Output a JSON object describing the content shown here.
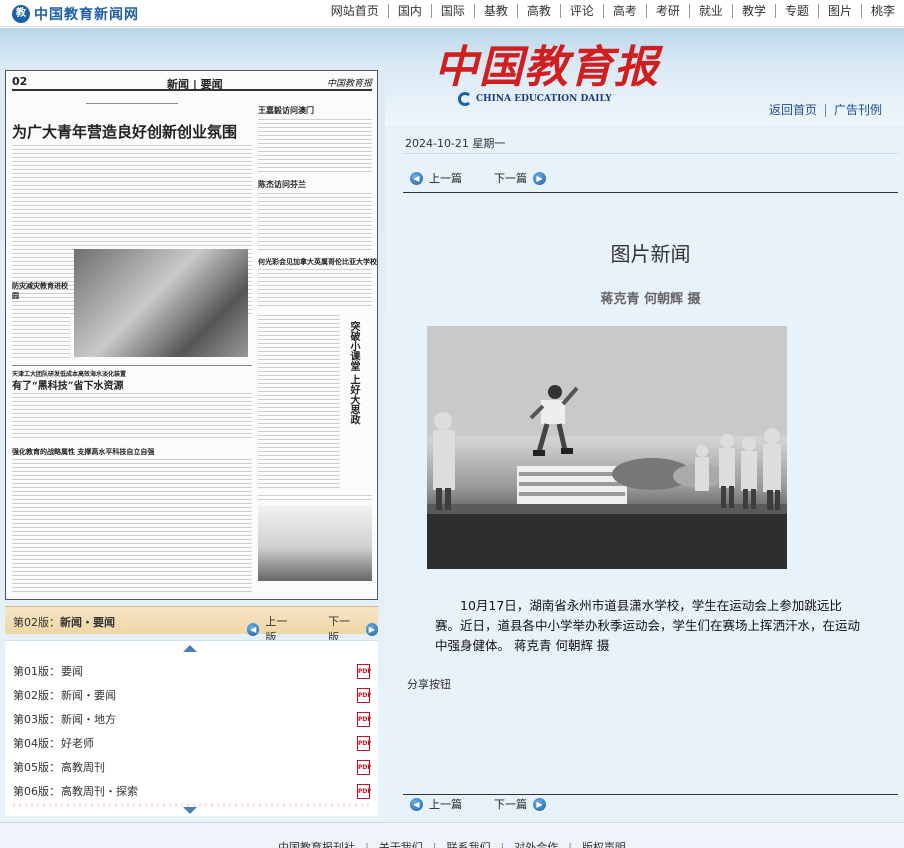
{
  "site": {
    "logo_text": "中国教育新闻网",
    "nav": [
      "网站首页",
      "国内",
      "国际",
      "基教",
      "高教",
      "评论",
      "高考",
      "考研",
      "就业",
      "教学",
      "专题",
      "图片",
      "桃李"
    ]
  },
  "banner": {
    "newspaper_name": "中国教育报",
    "newspaper_en": "CHINA EDUCATION DAILY",
    "links": [
      "返回首页",
      "广告刊例"
    ]
  },
  "paper_preview": {
    "page_no": "02",
    "section": "新闻 | 要闻",
    "headline": "为广大青年营造良好创新创业氛围",
    "subheads": [
      "王嘉毅访问澳门",
      "陈杰访问芬兰",
      "何光彩会见加拿大英属哥伦比亚大学校长",
      "防灾减灾教育进校园",
      "天津工大团队研发低成本高效海水淡化装置",
      "有了“黑科技”省下水资源",
      "强化教育的战略属性 支撑高水平科技自立自强"
    ],
    "vertical_title": "突破小课堂 上好大思政"
  },
  "edition_bar": {
    "label_prefix": "第02版：",
    "label_name": "新闻・要闻",
    "prev": "上一版",
    "next": "下一版"
  },
  "editions": [
    {
      "no": "第01版：",
      "name": "要闻"
    },
    {
      "no": "第02版：",
      "name": "新闻・要闻"
    },
    {
      "no": "第03版：",
      "name": "新闻・地方"
    },
    {
      "no": "第04版：",
      "name": "好老师"
    },
    {
      "no": "第05版：",
      "name": "高教周刊"
    },
    {
      "no": "第06版：",
      "name": "高教周刊・探索"
    }
  ],
  "article": {
    "date": "2024-10-21  星期一",
    "prev": "上一篇",
    "next": "下一篇",
    "title": "图片新闻",
    "author": "蒋克青  何朝辉  摄",
    "caption": "10月17日，湖南省永州市道县潇水学校，学生在运动会上参加跳远比赛。近日，道县各中小学举办秋季运动会，学生们在赛场上挥洒汗水，在运动中强身健体。   蒋克青  何朝辉  摄",
    "share": "分享按钮"
  },
  "footer": {
    "links": [
      "中国教育报刊社",
      "关于我们",
      "联系我们",
      "对外合作",
      "版权声明"
    ]
  },
  "colors": {
    "accent_red": "#d11e1e",
    "accent_blue": "#1b62a8",
    "edition_bar": "#efd6a4"
  }
}
